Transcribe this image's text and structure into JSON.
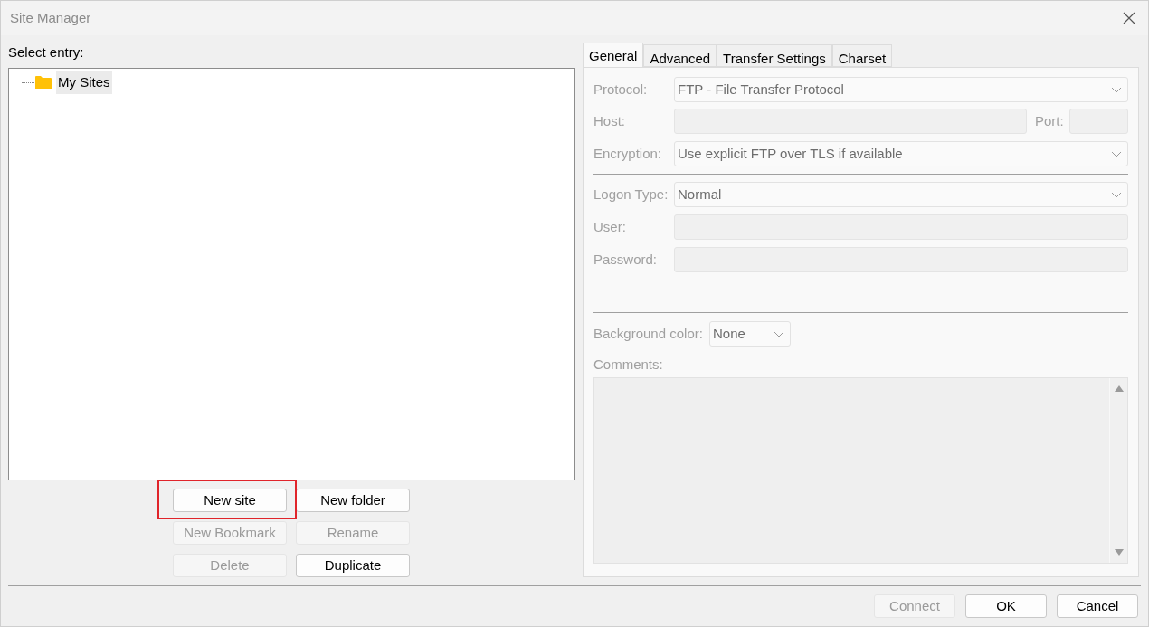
{
  "window": {
    "title": "Site Manager"
  },
  "tree": {
    "label": "Select entry:",
    "items": [
      {
        "label": "My Sites",
        "selected": true
      }
    ]
  },
  "tree_buttons": [
    {
      "label": "New site",
      "disabled": false,
      "highlighted": true
    },
    {
      "label": "New folder",
      "disabled": false,
      "highlighted": false
    },
    {
      "label": "New Bookmark",
      "disabled": true,
      "highlighted": false
    },
    {
      "label": "Rename",
      "disabled": true,
      "highlighted": false
    },
    {
      "label": "Delete",
      "disabled": true,
      "highlighted": false
    },
    {
      "label": "Duplicate",
      "disabled": false,
      "highlighted": false
    }
  ],
  "tabs": [
    {
      "label": "General",
      "selected": true
    },
    {
      "label": "Advanced",
      "selected": false
    },
    {
      "label": "Transfer Settings",
      "selected": false
    },
    {
      "label": "Charset",
      "selected": false
    }
  ],
  "general": {
    "disabled": true,
    "protocol": {
      "label": "Protocol:",
      "value": "FTP - File Transfer Protocol"
    },
    "host": {
      "label": "Host:"
    },
    "port": {
      "label": "Port:"
    },
    "encryption": {
      "label": "Encryption:",
      "value": "Use explicit FTP over TLS if available"
    },
    "logon_type": {
      "label": "Logon Type:",
      "value": "Normal"
    },
    "user": {
      "label": "User:"
    },
    "password": {
      "label": "Password:"
    },
    "background_color": {
      "label": "Background color:",
      "value": "None"
    },
    "comments": {
      "label": "Comments:"
    }
  },
  "footer_buttons": [
    {
      "label": "Connect",
      "disabled": true
    },
    {
      "label": "OK",
      "disabled": false
    },
    {
      "label": "Cancel",
      "disabled": false
    }
  ]
}
